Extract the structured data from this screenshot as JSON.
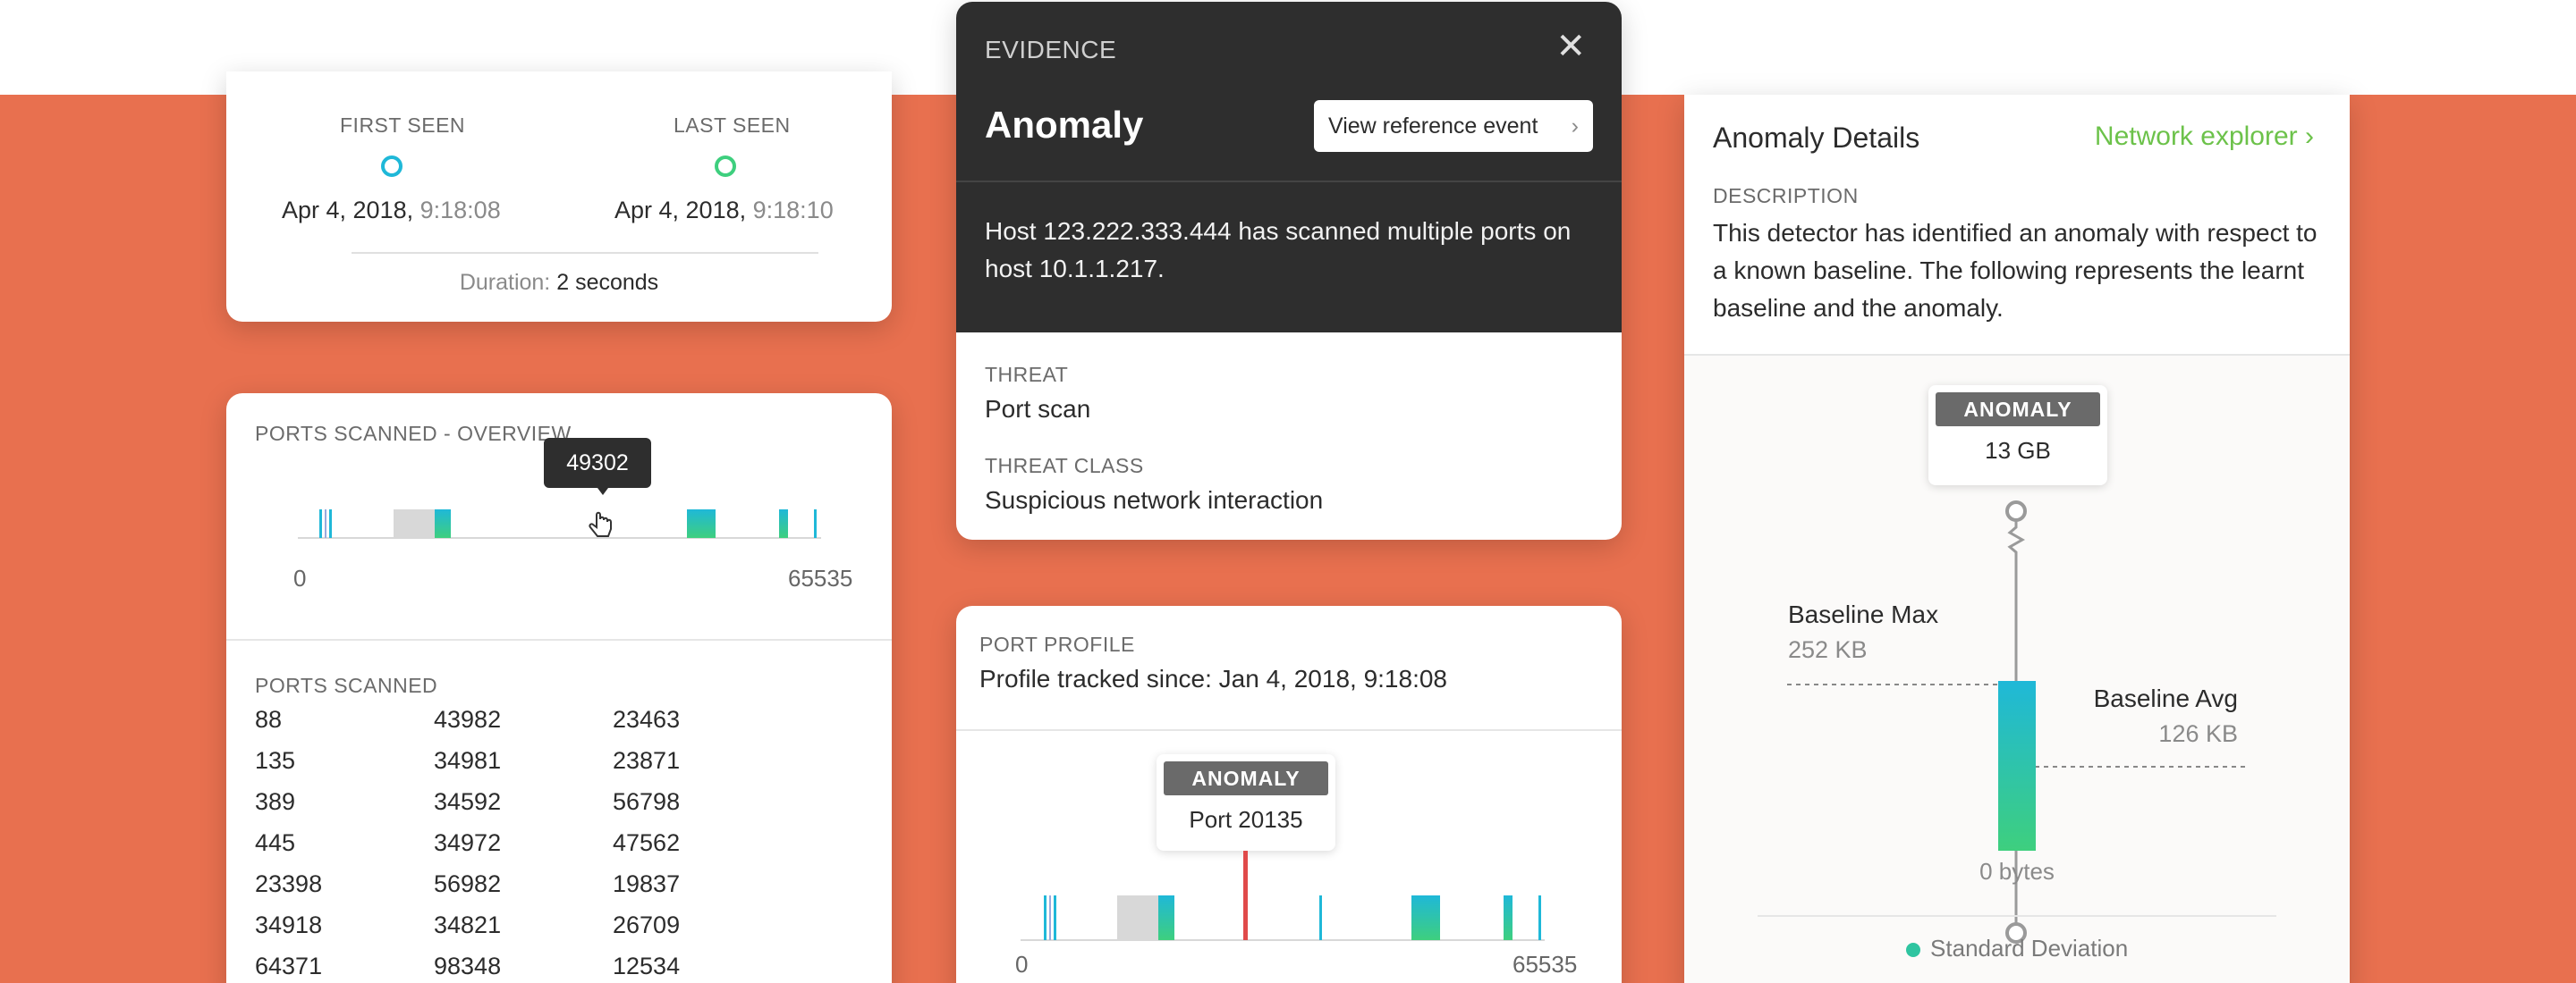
{
  "timeline": {
    "first_seen_label": "FIRST SEEN",
    "last_seen_label": "LAST SEEN",
    "first_date": "Apr 4, 2018,",
    "first_time": "9:18:08",
    "last_date": "Apr 4, 2018,",
    "last_time": "9:18:10",
    "duration_label": "Duration:",
    "duration_value": "2 seconds"
  },
  "ports_overview": {
    "title": "PORTS SCANNED - OVERVIEW",
    "tooltip": "49302",
    "axis_min": "0",
    "axis_max": "65535"
  },
  "ports_scanned": {
    "title": "PORTS SCANNED",
    "rows": [
      [
        "88",
        "43982",
        "23463"
      ],
      [
        "135",
        "34981",
        "23871"
      ],
      [
        "389",
        "34592",
        "56798"
      ],
      [
        "445",
        "34972",
        "47562"
      ],
      [
        "23398",
        "56982",
        "19837"
      ],
      [
        "34918",
        "34821",
        "26709"
      ],
      [
        "64371",
        "98348",
        "12534"
      ]
    ]
  },
  "evidence": {
    "header": "EVIDENCE",
    "title": "Anomaly",
    "ref_button": "View reference event",
    "description": "Host 123.222.333.444 has scanned multiple ports on host 10.1.1.217.",
    "threat_label": "THREAT",
    "threat_value": "Port scan",
    "threat_class_label": "THREAT CLASS",
    "threat_class_value": "Suspicious network interaction"
  },
  "port_profile": {
    "title": "PORT PROFILE",
    "tracked": "Profile tracked since: Jan 4, 2018, 9:18:08",
    "anomaly_tag": "ANOMALY",
    "anomaly_port": "Port 20135",
    "axis_min": "0",
    "axis_max": "65535"
  },
  "details": {
    "title": "Anomaly Details",
    "network_link": "Network explorer",
    "description_label": "DESCRIPTION",
    "description": "This detector has identified an anomaly with respect to a known baseline. The following represents the learnt baseline and the anomaly.",
    "anomaly_tag": "ANOMALY",
    "anomaly_value": "13 GB",
    "baseline_max_label": "Baseline Max",
    "baseline_max_value": "252 KB",
    "baseline_avg_label": "Baseline Avg",
    "baseline_avg_value": "126 KB",
    "zero_label": "0 bytes",
    "legend": "Standard Deviation"
  },
  "colors": {
    "background": "#e8704f",
    "dark": "#2e2e2e",
    "teal": "#1fb8d8",
    "green": "#3ecf7e",
    "link": "#6cc24a",
    "anomaly_line": "#e04a4a"
  }
}
